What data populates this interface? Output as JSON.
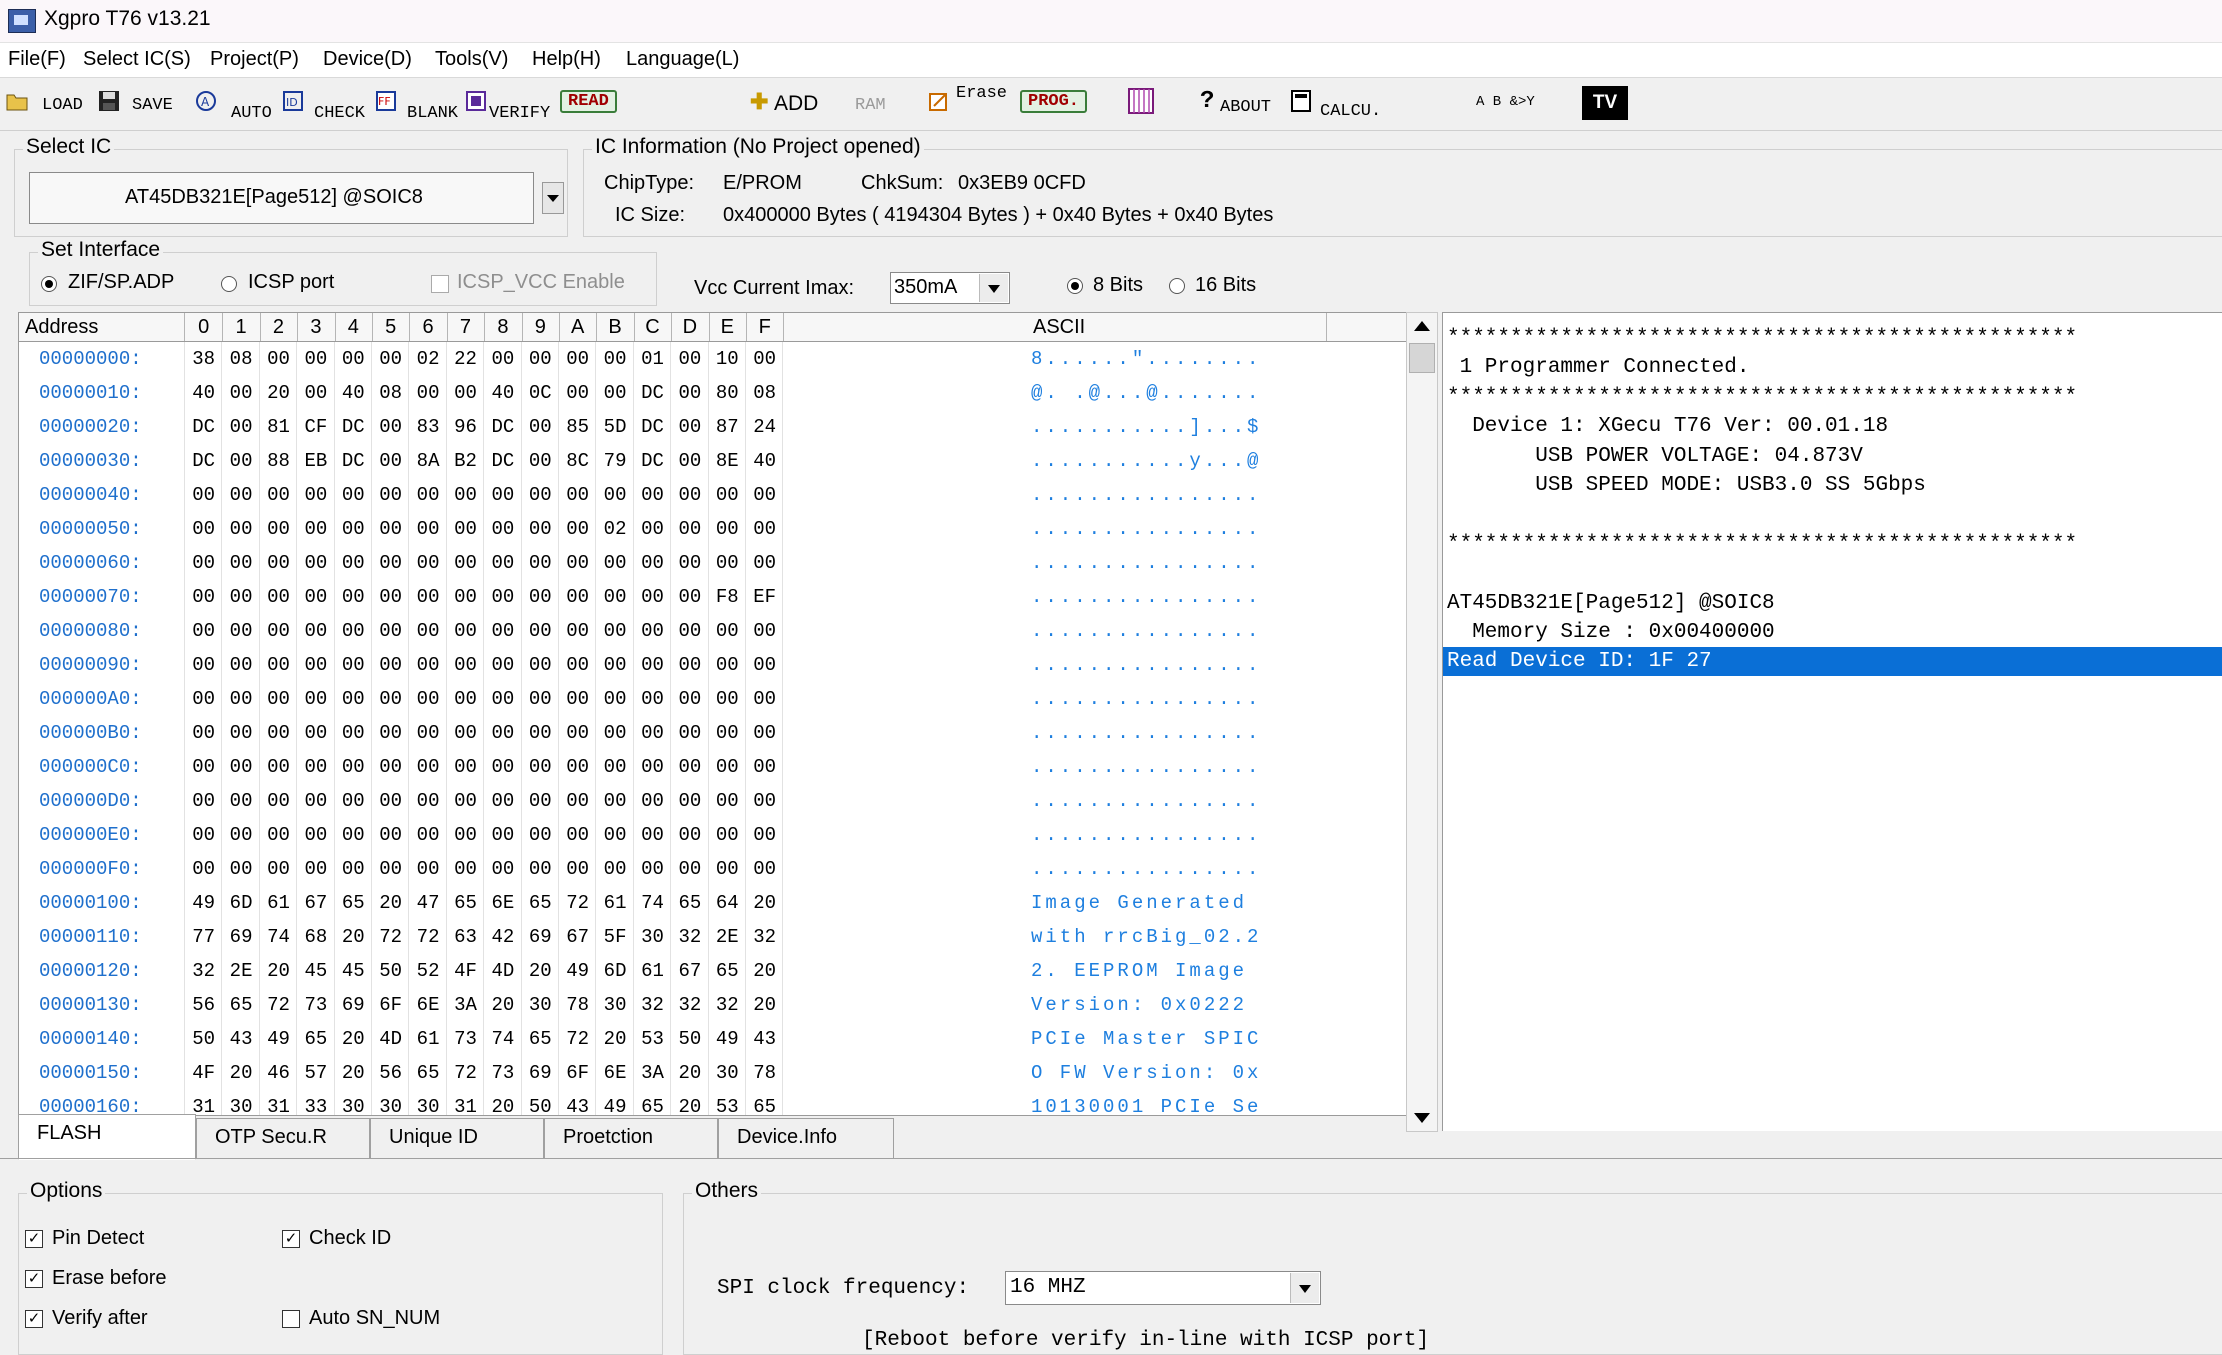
{
  "window": {
    "title": "Xgpro T76 v13.21"
  },
  "menu": [
    "File(F)",
    "Select IC(S)",
    "Project(P)",
    "Device(D)",
    "Tools(V)",
    "Help(H)",
    "Language(L)"
  ],
  "toolbar": {
    "load": "LOAD",
    "save": "SAVE",
    "auto": "AUTO",
    "check": "CHECK",
    "blank": "BLANK",
    "verify": "VERIFY",
    "read": "READ",
    "add": "ADD",
    "ram": "RAM",
    "erase": "Erase",
    "prog": "PROG.",
    "about": "ABOUT",
    "calcu": "CALCU.",
    "logic": "A B &>Y",
    "tv": "TV"
  },
  "select_ic": {
    "label": "Select IC",
    "value": "AT45DB321E[Page512] @SOIC8"
  },
  "ic_info": {
    "label": "IC Information (No Project opened)",
    "chip_type_label": "ChipType:",
    "chip_type": "E/PROM",
    "chksum_label": "ChkSum:",
    "chksum": "0x3EB9 0CFD",
    "ic_size_label": "IC Size:",
    "ic_size": "0x400000 Bytes ( 4194304 Bytes ) + 0x40 Bytes + 0x40 Bytes"
  },
  "interface": {
    "label": "Set Interface",
    "zif": "ZIF/SP.ADP",
    "icsp": "ICSP port",
    "icsp_vcc": "ICSP_VCC Enable",
    "vcc_label": "Vcc Current Imax:",
    "vcc_value": "350mA",
    "bits8": "8 Bits",
    "bits16": "16 Bits"
  },
  "hex": {
    "columns": [
      "Address",
      "0",
      "1",
      "2",
      "3",
      "4",
      "5",
      "6",
      "7",
      "8",
      "9",
      "A",
      "B",
      "C",
      "D",
      "E",
      "F",
      "ASCII"
    ],
    "rows": [
      {
        "addr": "00000000:",
        "b": [
          "38",
          "08",
          "00",
          "00",
          "00",
          "00",
          "02",
          "22",
          "00",
          "00",
          "00",
          "00",
          "01",
          "00",
          "10",
          "00"
        ],
        "ascii": "8......\"........"
      },
      {
        "addr": "00000010:",
        "b": [
          "40",
          "00",
          "20",
          "00",
          "40",
          "08",
          "00",
          "00",
          "40",
          "0C",
          "00",
          "00",
          "DC",
          "00",
          "80",
          "08"
        ],
        "ascii": "@. .@...@......."
      },
      {
        "addr": "00000020:",
        "b": [
          "DC",
          "00",
          "81",
          "CF",
          "DC",
          "00",
          "83",
          "96",
          "DC",
          "00",
          "85",
          "5D",
          "DC",
          "00",
          "87",
          "24"
        ],
        "ascii": "...........]...$"
      },
      {
        "addr": "00000030:",
        "b": [
          "DC",
          "00",
          "88",
          "EB",
          "DC",
          "00",
          "8A",
          "B2",
          "DC",
          "00",
          "8C",
          "79",
          "DC",
          "00",
          "8E",
          "40"
        ],
        "ascii": "...........y...@"
      },
      {
        "addr": "00000040:",
        "b": [
          "00",
          "00",
          "00",
          "00",
          "00",
          "00",
          "00",
          "00",
          "00",
          "00",
          "00",
          "00",
          "00",
          "00",
          "00",
          "00"
        ],
        "ascii": "................"
      },
      {
        "addr": "00000050:",
        "b": [
          "00",
          "00",
          "00",
          "00",
          "00",
          "00",
          "00",
          "00",
          "00",
          "00",
          "00",
          "02",
          "00",
          "00",
          "00",
          "00"
        ],
        "ascii": "................"
      },
      {
        "addr": "00000060:",
        "b": [
          "00",
          "00",
          "00",
          "00",
          "00",
          "00",
          "00",
          "00",
          "00",
          "00",
          "00",
          "00",
          "00",
          "00",
          "00",
          "00"
        ],
        "ascii": "................"
      },
      {
        "addr": "00000070:",
        "b": [
          "00",
          "00",
          "00",
          "00",
          "00",
          "00",
          "00",
          "00",
          "00",
          "00",
          "00",
          "00",
          "00",
          "00",
          "F8",
          "EF"
        ],
        "ascii": "................"
      },
      {
        "addr": "00000080:",
        "b": [
          "00",
          "00",
          "00",
          "00",
          "00",
          "00",
          "00",
          "00",
          "00",
          "00",
          "00",
          "00",
          "00",
          "00",
          "00",
          "00"
        ],
        "ascii": "................"
      },
      {
        "addr": "00000090:",
        "b": [
          "00",
          "00",
          "00",
          "00",
          "00",
          "00",
          "00",
          "00",
          "00",
          "00",
          "00",
          "00",
          "00",
          "00",
          "00",
          "00"
        ],
        "ascii": "................"
      },
      {
        "addr": "000000A0:",
        "b": [
          "00",
          "00",
          "00",
          "00",
          "00",
          "00",
          "00",
          "00",
          "00",
          "00",
          "00",
          "00",
          "00",
          "00",
          "00",
          "00"
        ],
        "ascii": "................"
      },
      {
        "addr": "000000B0:",
        "b": [
          "00",
          "00",
          "00",
          "00",
          "00",
          "00",
          "00",
          "00",
          "00",
          "00",
          "00",
          "00",
          "00",
          "00",
          "00",
          "00"
        ],
        "ascii": "................"
      },
      {
        "addr": "000000C0:",
        "b": [
          "00",
          "00",
          "00",
          "00",
          "00",
          "00",
          "00",
          "00",
          "00",
          "00",
          "00",
          "00",
          "00",
          "00",
          "00",
          "00"
        ],
        "ascii": "................"
      },
      {
        "addr": "000000D0:",
        "b": [
          "00",
          "00",
          "00",
          "00",
          "00",
          "00",
          "00",
          "00",
          "00",
          "00",
          "00",
          "00",
          "00",
          "00",
          "00",
          "00"
        ],
        "ascii": "................"
      },
      {
        "addr": "000000E0:",
        "b": [
          "00",
          "00",
          "00",
          "00",
          "00",
          "00",
          "00",
          "00",
          "00",
          "00",
          "00",
          "00",
          "00",
          "00",
          "00",
          "00"
        ],
        "ascii": "................"
      },
      {
        "addr": "000000F0:",
        "b": [
          "00",
          "00",
          "00",
          "00",
          "00",
          "00",
          "00",
          "00",
          "00",
          "00",
          "00",
          "00",
          "00",
          "00",
          "00",
          "00"
        ],
        "ascii": "................"
      },
      {
        "addr": "00000100:",
        "b": [
          "49",
          "6D",
          "61",
          "67",
          "65",
          "20",
          "47",
          "65",
          "6E",
          "65",
          "72",
          "61",
          "74",
          "65",
          "64",
          "20"
        ],
        "ascii": "Image Generated "
      },
      {
        "addr": "00000110:",
        "b": [
          "77",
          "69",
          "74",
          "68",
          "20",
          "72",
          "72",
          "63",
          "42",
          "69",
          "67",
          "5F",
          "30",
          "32",
          "2E",
          "32"
        ],
        "ascii": "with rrcBig_02.2"
      },
      {
        "addr": "00000120:",
        "b": [
          "32",
          "2E",
          "20",
          "45",
          "45",
          "50",
          "52",
          "4F",
          "4D",
          "20",
          "49",
          "6D",
          "61",
          "67",
          "65",
          "20"
        ],
        "ascii": "2. EEPROM Image "
      },
      {
        "addr": "00000130:",
        "b": [
          "56",
          "65",
          "72",
          "73",
          "69",
          "6F",
          "6E",
          "3A",
          "20",
          "30",
          "78",
          "30",
          "32",
          "32",
          "32",
          "20"
        ],
        "ascii": "Version: 0x0222 "
      },
      {
        "addr": "00000140:",
        "b": [
          "50",
          "43",
          "49",
          "65",
          "20",
          "4D",
          "61",
          "73",
          "74",
          "65",
          "72",
          "20",
          "53",
          "50",
          "49",
          "43"
        ],
        "ascii": "PCIe Master SPIC"
      },
      {
        "addr": "00000150:",
        "b": [
          "4F",
          "20",
          "46",
          "57",
          "20",
          "56",
          "65",
          "72",
          "73",
          "69",
          "6F",
          "6E",
          "3A",
          "20",
          "30",
          "78"
        ],
        "ascii": "O FW Version: 0x"
      },
      {
        "addr": "00000160:",
        "b": [
          "31",
          "30",
          "31",
          "33",
          "30",
          "30",
          "30",
          "31",
          "20",
          "50",
          "43",
          "49",
          "65",
          "20",
          "53",
          "65"
        ],
        "ascii": "10130001 PCIe Se"
      }
    ]
  },
  "log": [
    {
      "text": "**************************************************",
      "hl": false
    },
    {
      "text": " 1 Programmer Connected.",
      "hl": false
    },
    {
      "text": "**************************************************",
      "hl": false
    },
    {
      "text": "  Device 1: XGecu T76 Ver: 00.01.18",
      "hl": false
    },
    {
      "text": "       USB POWER VOLTAGE: 04.873V",
      "hl": false
    },
    {
      "text": "       USB SPEED MODE: USB3.0 SS 5Gbps",
      "hl": false
    },
    {
      "text": "",
      "hl": false
    },
    {
      "text": "**************************************************",
      "hl": false
    },
    {
      "text": "",
      "hl": false
    },
    {
      "text": "AT45DB321E[Page512] @SOIC8",
      "hl": false
    },
    {
      "text": "  Memory Size : 0x00400000",
      "hl": false
    },
    {
      "text": "Read Device ID: 1F 27",
      "hl": true
    }
  ],
  "tabs": [
    "FLASH",
    "OTP Secu.R",
    "Unique ID",
    "Proetction",
    "Device.Info"
  ],
  "options": {
    "label": "Options",
    "pin_detect": "Pin Detect",
    "check_id": "Check ID",
    "erase_before": "Erase before",
    "verify_after": "Verify after",
    "auto_sn": "Auto SN_NUM"
  },
  "others": {
    "label": "Others",
    "spi_label": "SPI clock frequency:",
    "spi_value": "16  MHZ",
    "partial": "[Reboot before verify in-line with ICSP port]"
  },
  "colors": {
    "accent": "#0a6fd6",
    "address": "#1e6fcc",
    "ascii": "#1e7fdf"
  }
}
